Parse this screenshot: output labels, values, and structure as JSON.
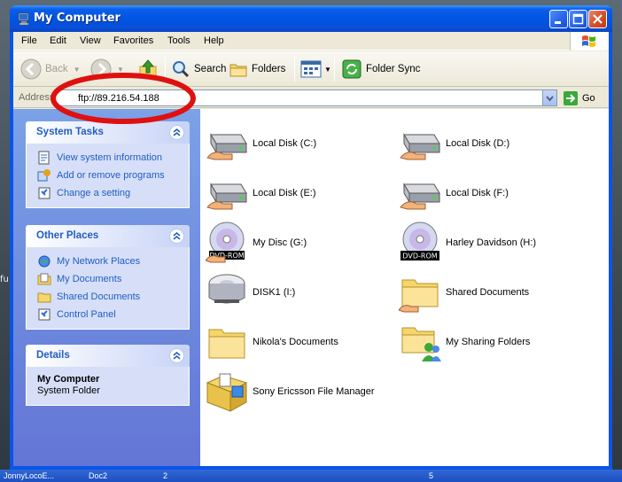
{
  "window": {
    "title": "My Computer",
    "colors": {
      "titlebar": "#0054e3",
      "pane": "#6375d6",
      "link": "#215dc6",
      "annotation": "#e01010"
    }
  },
  "menu": [
    "File",
    "Edit",
    "View",
    "Favorites",
    "Tools",
    "Help"
  ],
  "toolbar": {
    "back": "Back",
    "search": "Search",
    "folders": "Folders",
    "folder_sync": "Folder Sync"
  },
  "address": {
    "label": "Address",
    "value": "ftp://89.216.54.188",
    "go": "Go"
  },
  "system_tasks": {
    "title": "System Tasks",
    "items": [
      "View system information",
      "Add or remove programs",
      "Change a setting"
    ]
  },
  "other_places": {
    "title": "Other Places",
    "items": [
      "My Network Places",
      "My Documents",
      "Shared Documents",
      "Control Panel"
    ]
  },
  "details": {
    "title": "Details",
    "name": "My Computer",
    "type": "System Folder"
  },
  "items": [
    {
      "name": "Local Disk (C:)",
      "icon": "hard-disk-shared-icon"
    },
    {
      "name": "Local Disk (D:)",
      "icon": "hard-disk-shared-icon"
    },
    {
      "name": "Local Disk (E:)",
      "icon": "hard-disk-shared-icon"
    },
    {
      "name": "Local Disk (F:)",
      "icon": "hard-disk-shared-icon"
    },
    {
      "name": "My Disc (G:)",
      "icon": "dvd-rom-shared-icon",
      "badge": "DVD-ROM"
    },
    {
      "name": "Harley Davidson (H:)",
      "icon": "dvd-rom-icon",
      "badge": "DVD-ROM"
    },
    {
      "name": "DISK1 (I:)",
      "icon": "removable-disk-icon"
    },
    {
      "name": "Shared Documents",
      "icon": "shared-folder-icon"
    },
    {
      "name": "Nikola's Documents",
      "icon": "folder-icon"
    },
    {
      "name": "My Sharing Folders",
      "icon": "sharing-folders-icon"
    },
    {
      "name": "Sony Ericsson File Manager",
      "icon": "file-manager-icon"
    }
  ],
  "taskbar": [
    "JonnyLocoE...",
    "Doc2",
    "2",
    "5"
  ],
  "desktop": [
    "fu"
  ]
}
